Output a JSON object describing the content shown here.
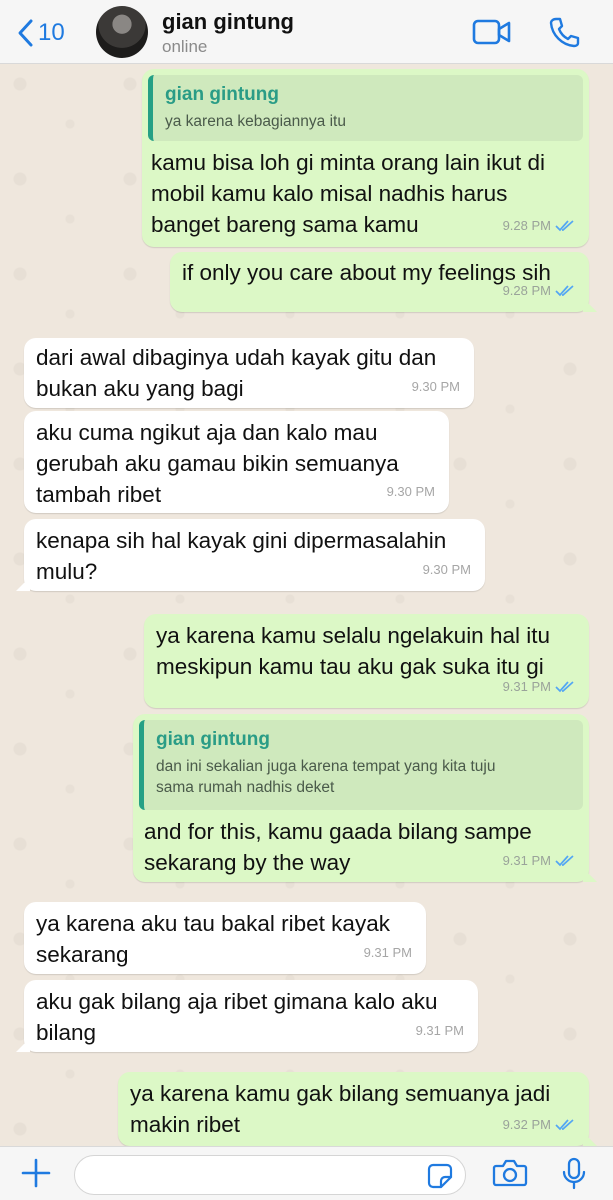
{
  "header": {
    "back_count": "10",
    "contact_name": "gian gintung",
    "status": "online",
    "accent": "#1f7ae0"
  },
  "messages": [
    {
      "dir": "out",
      "quote": {
        "name": "gian gintung",
        "text": "ya karena kebagiannya itu"
      },
      "text": "kamu bisa loh gi minta orang lain ikut di\nmobil kamu kalo misal nadhis harus\nbanget bareng sama kamu",
      "time": "9.28 PM",
      "read": true
    },
    {
      "dir": "out",
      "text": "if only you care about my feelings sih",
      "time": "9.28 PM",
      "read": true
    },
    {
      "dir": "in",
      "text": "dari awal dibaginya udah kayak gitu dan\nbukan aku yang bagi",
      "time": "9.30 PM"
    },
    {
      "dir": "in",
      "text": "aku cuma ngikut aja dan kalo mau\ngerubah aku gamau bikin semuanya\ntambah ribet",
      "time": "9.30 PM"
    },
    {
      "dir": "in",
      "text": "kenapa sih hal kayak gini dipermasalahin\nmulu?",
      "time": "9.30 PM"
    },
    {
      "dir": "out",
      "text": "ya karena kamu selalu ngelakuin hal itu\nmeskipun kamu tau aku gak suka itu gi",
      "time": "9.31 PM",
      "read": true
    },
    {
      "dir": "out",
      "quote": {
        "name": "gian gintung",
        "text": "dan ini sekalian juga karena tempat yang kita tuju\nsama rumah nadhis deket"
      },
      "text": "and for this, kamu gaada bilang sampe\nsekarang by the way",
      "time": "9.31 PM",
      "read": true
    },
    {
      "dir": "in",
      "text": "ya karena aku tau bakal ribet kayak\nsekarang",
      "time": "9.31 PM"
    },
    {
      "dir": "in",
      "text": "aku gak bilang aja ribet gimana kalo aku\nbilang",
      "time": "9.31 PM"
    },
    {
      "dir": "out",
      "text": "ya karena kamu gak bilang semuanya jadi\nmakin ribet",
      "time": "9.32 PM",
      "read": true
    }
  ],
  "composer": {
    "placeholder": ""
  },
  "colors": {
    "outgoing": "#dcf8c6",
    "incoming": "#ffffff",
    "read_ticks": "#53a6f4",
    "quote_name": "#2a9c86"
  }
}
